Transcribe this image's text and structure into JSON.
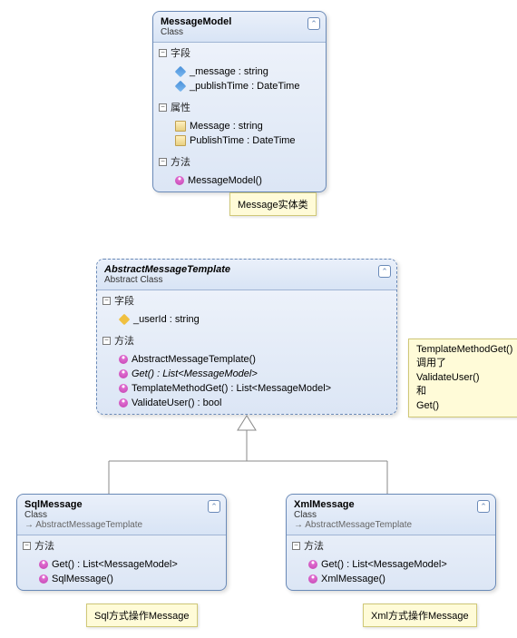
{
  "classes": {
    "messageModel": {
      "name": "MessageModel",
      "stereotype": "Class",
      "sections": {
        "fields": {
          "label": "字段",
          "members": [
            {
              "name": "_message : string",
              "iconType": "field"
            },
            {
              "name": "_publishTime : DateTime",
              "iconType": "field"
            }
          ]
        },
        "props": {
          "label": "属性",
          "members": [
            {
              "name": "Message : string",
              "iconType": "prop"
            },
            {
              "name": "PublishTime : DateTime",
              "iconType": "prop"
            }
          ]
        },
        "methods": {
          "label": "方法",
          "members": [
            {
              "name": "MessageModel()",
              "iconType": "method"
            }
          ]
        }
      }
    },
    "abstractTemplate": {
      "name": "AbstractMessageTemplate",
      "stereotype": "Abstract Class",
      "sections": {
        "fields": {
          "label": "字段",
          "members": [
            {
              "name": "_userId : string",
              "iconType": "field-key"
            }
          ]
        },
        "methods": {
          "label": "方法",
          "members": [
            {
              "name": "AbstractMessageTemplate()",
              "iconType": "method"
            },
            {
              "name": "Get() : List<MessageModel>",
              "iconType": "method",
              "italic": true
            },
            {
              "name": "TemplateMethodGet() : List<MessageModel>",
              "iconType": "method"
            },
            {
              "name": "ValidateUser() : bool",
              "iconType": "method"
            }
          ]
        }
      }
    },
    "sqlMessage": {
      "name": "SqlMessage",
      "stereotype": "Class",
      "inherits": "AbstractMessageTemplate",
      "sections": {
        "methods": {
          "label": "方法",
          "members": [
            {
              "name": "Get() : List<MessageModel>",
              "iconType": "method"
            },
            {
              "name": "SqlMessage()",
              "iconType": "method"
            }
          ]
        }
      }
    },
    "xmlMessage": {
      "name": "XmlMessage",
      "stereotype": "Class",
      "inherits": "AbstractMessageTemplate",
      "sections": {
        "methods": {
          "label": "方法",
          "members": [
            {
              "name": "Get() : List<MessageModel>",
              "iconType": "method"
            },
            {
              "name": "XmlMessage()",
              "iconType": "method"
            }
          ]
        }
      }
    }
  },
  "notes": {
    "note1": "Message实体类",
    "note2": "TemplateMethodGet()\n调用了\nValidateUser()\n和\nGet()",
    "note3": "Sql方式操作Message",
    "note4": "Xml方式操作Message"
  },
  "toggleMinus": "−",
  "chevronUp": "⌃"
}
